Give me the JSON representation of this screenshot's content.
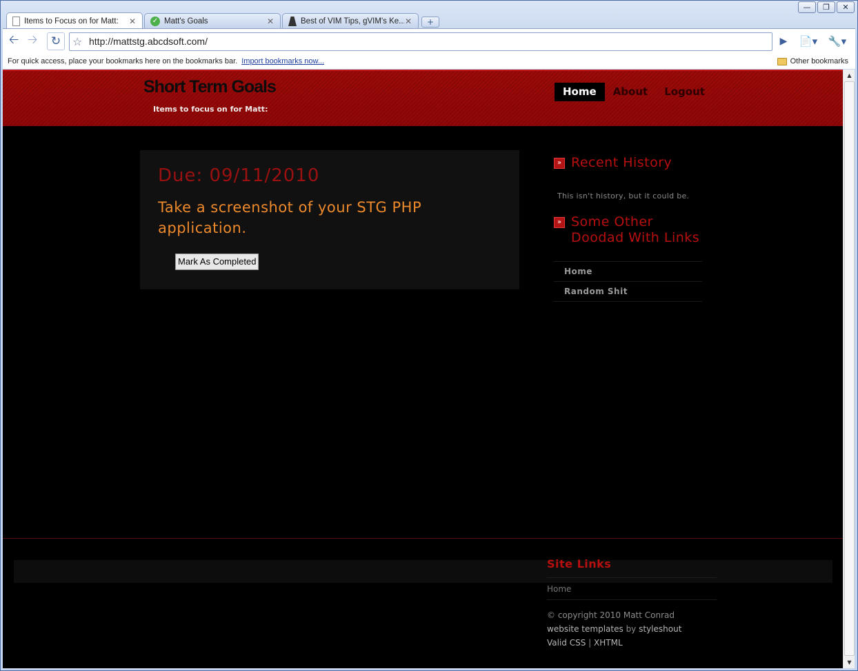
{
  "browser": {
    "tabs": [
      {
        "title": "Items to Focus on for Matt:",
        "icon": "page-icon",
        "active": true
      },
      {
        "title": "Matt's Goals",
        "icon": "check-icon",
        "active": false
      },
      {
        "title": "Best of VIM Tips, gVIM's Ke...",
        "icon": "vim-icon",
        "active": false
      }
    ],
    "url": "http://mattstg.abcdsoft.com/",
    "bookmarks_hint": "For quick access, place your bookmarks here on the bookmarks bar.",
    "bookmarks_import": "Import bookmarks now...",
    "other_bookmarks": "Other bookmarks"
  },
  "site": {
    "title": "Short Term Goals",
    "slogan": "Items to focus on for Matt:",
    "nav": [
      "Home",
      "About",
      "Logout"
    ]
  },
  "goal": {
    "due": "Due: 09/11/2010",
    "task": "Take a screenshot of your STG PHP application.",
    "button": "Mark As Completed"
  },
  "sidebar": {
    "recent_title": "Recent History",
    "recent_text": "This isn't history, but it could be.",
    "links_title": "Some Other Doodad With Links",
    "links": [
      "Home",
      "Random Shit"
    ]
  },
  "footer": {
    "title": "Site Links",
    "link": "Home",
    "copyright": "© copyright 2010 Matt Conrad",
    "templates_prefix": "website templates",
    "templates_by": "by",
    "templates_author": "styleshout",
    "valid_css": "Valid CSS",
    "separator": "|",
    "xhtml": "XHTML"
  },
  "colors": {
    "header_red": "#9f0b0b",
    "heading_red": "#b80f0f",
    "task_orange": "#ee8a2b",
    "background": "#000000"
  }
}
